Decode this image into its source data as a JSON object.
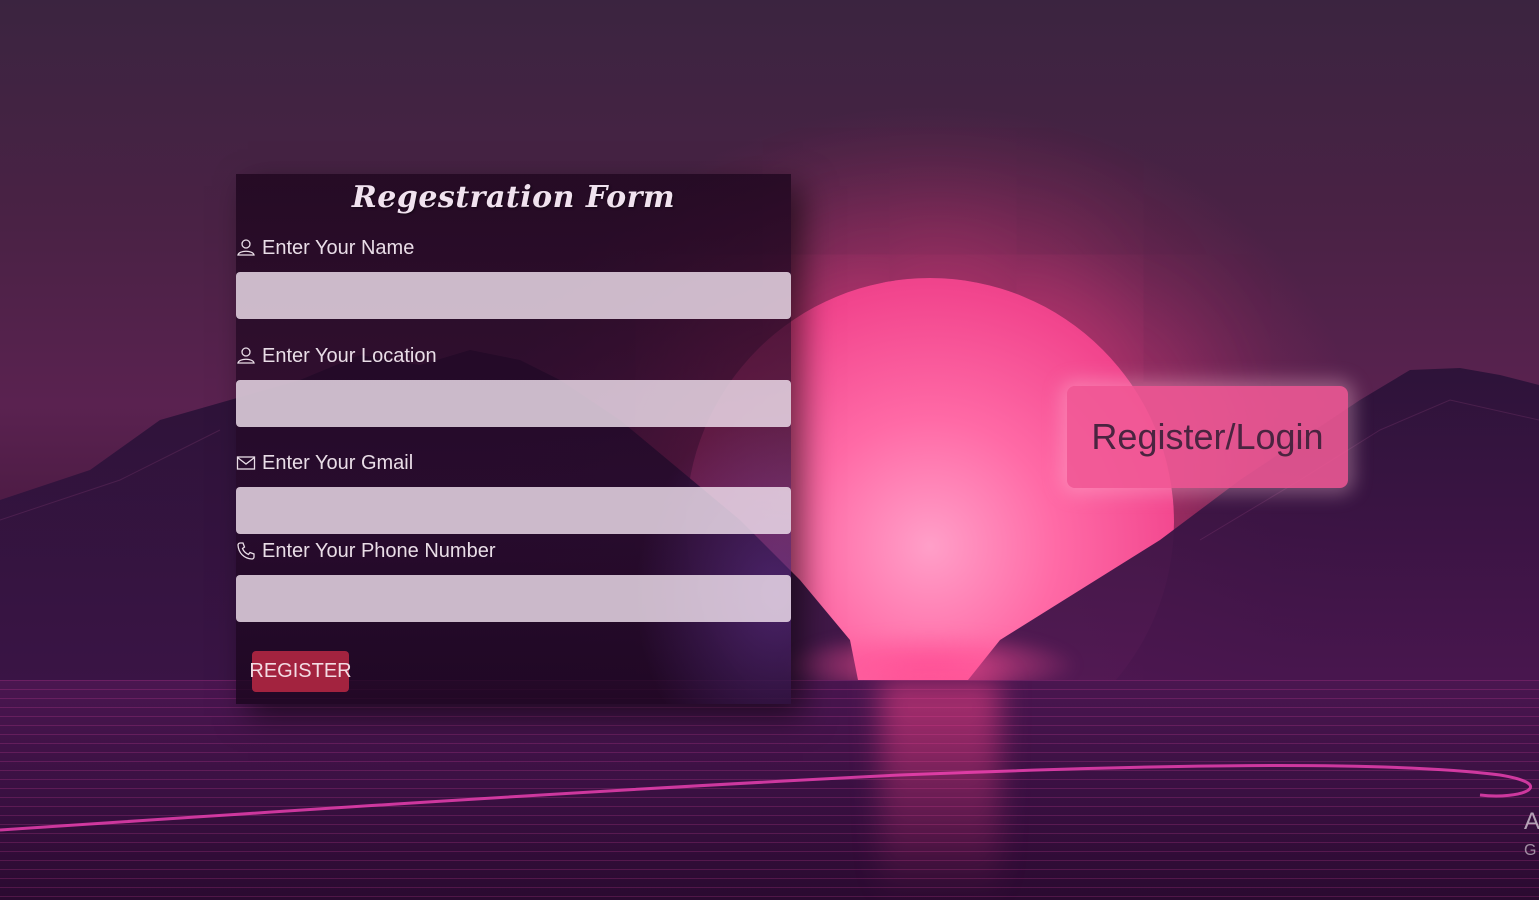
{
  "form": {
    "title": "Regestration Form",
    "fields": [
      {
        "label": "Enter Your Name",
        "icon": "user-icon",
        "value": "",
        "placeholder": ""
      },
      {
        "label": "Enter Your Location",
        "icon": "user-icon",
        "value": "",
        "placeholder": ""
      },
      {
        "label": "Enter Your Gmail",
        "icon": "mail-icon",
        "value": "",
        "placeholder": ""
      },
      {
        "label": "Enter Your Phone Number",
        "icon": "phone-icon",
        "value": "",
        "placeholder": ""
      }
    ],
    "submit_label": "REGISTER"
  },
  "side_button": {
    "label": "Register/Login"
  },
  "watermark": {
    "line1": "A",
    "line2": "G"
  },
  "colors": {
    "register_button": "#a3233f",
    "login_button": "#f05a96",
    "sun": "#ff6aa6"
  }
}
